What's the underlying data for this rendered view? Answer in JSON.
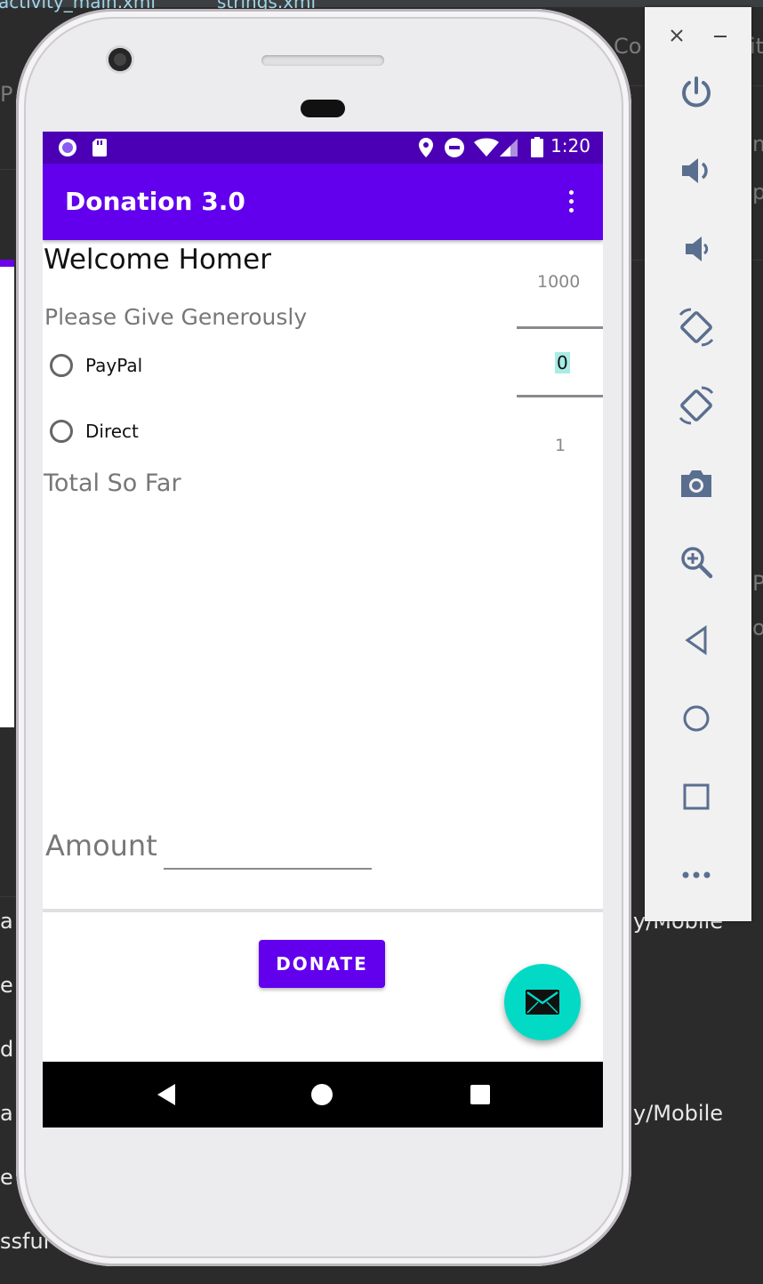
{
  "ide": {
    "tab1": "activity_main.xml",
    "tab2": "strings.xml",
    "right_fragments": [
      "Co",
      "it",
      "m",
      "p",
      "P",
      "o",
      "y/Mobile",
      "y/Mobile"
    ],
    "left_fragments": [
      "P",
      "a",
      "e",
      "d",
      "a",
      "e",
      "ssful"
    ]
  },
  "app": {
    "status_time": "1:20",
    "title": "Donation 3.0",
    "welcome": "Welcome Homer",
    "prompt": "Please Give Generously",
    "payment_options": [
      {
        "label": "PayPal",
        "selected": false
      },
      {
        "label": "Direct",
        "selected": false
      }
    ],
    "total_label": "Total So Far",
    "number_picker": {
      "max": "1000",
      "value": "0",
      "min": "1"
    },
    "amount_label": "Amount",
    "amount_value": "",
    "donate_label": "DONATE",
    "colors": {
      "primary": "#6200EE",
      "primary_dark": "#4C00B5",
      "accent": "#03DAC5"
    }
  },
  "emulator_toolbar": {
    "items": [
      "close-icon",
      "minimize-icon",
      "power-icon",
      "volume-up-icon",
      "volume-down-icon",
      "rotate-left-icon",
      "rotate-right-icon",
      "camera-icon",
      "zoom-icon",
      "back-icon",
      "home-icon",
      "overview-icon",
      "more-icon"
    ]
  }
}
